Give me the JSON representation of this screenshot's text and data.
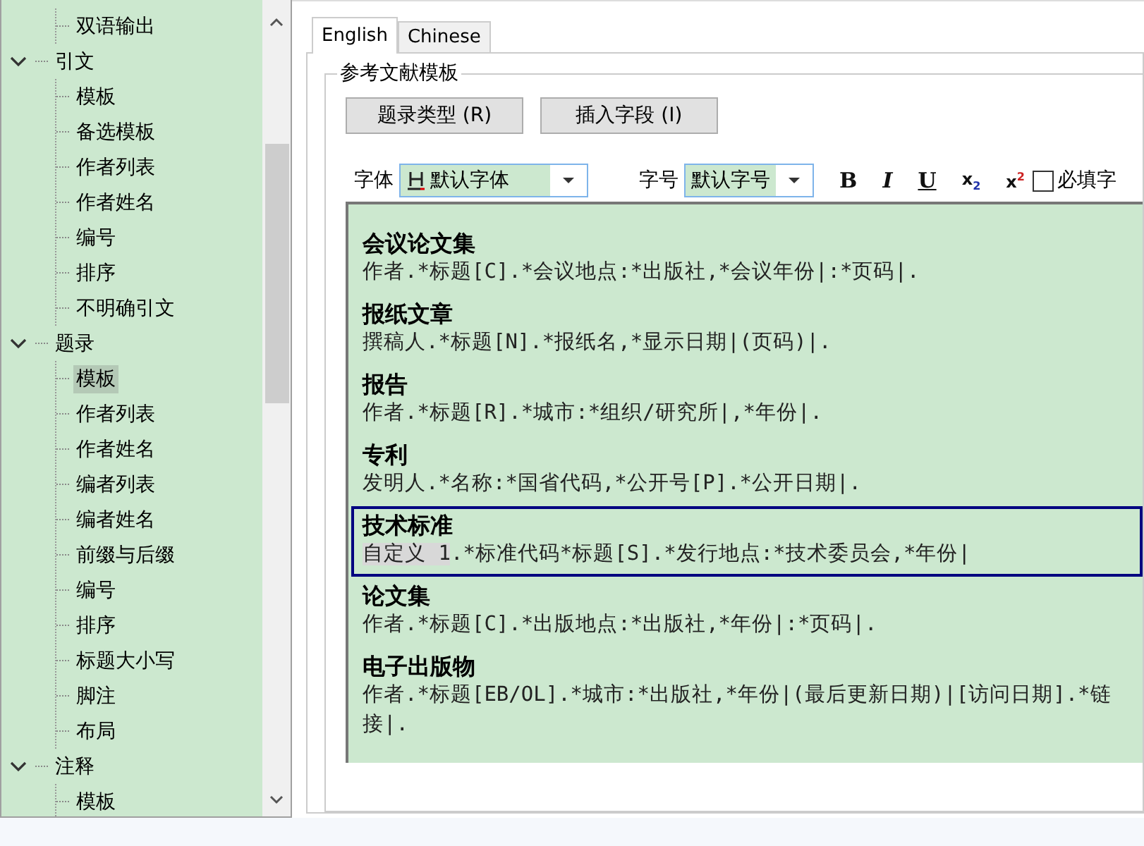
{
  "tree": {
    "items": [
      {
        "label": "双语输出",
        "selected": false
      },
      {
        "label": "引文",
        "expanded": true,
        "selected": false,
        "children": [
          {
            "label": "模板",
            "selected": false
          },
          {
            "label": "备选模板",
            "selected": false
          },
          {
            "label": "作者列表",
            "selected": false
          },
          {
            "label": "作者姓名",
            "selected": false
          },
          {
            "label": "编号",
            "selected": false
          },
          {
            "label": "排序",
            "selected": false
          },
          {
            "label": "不明确引文",
            "selected": false
          }
        ]
      },
      {
        "label": "题录",
        "expanded": true,
        "selected": false,
        "children": [
          {
            "label": "模板",
            "selected": true
          },
          {
            "label": "作者列表",
            "selected": false
          },
          {
            "label": "作者姓名",
            "selected": false
          },
          {
            "label": "编者列表",
            "selected": false
          },
          {
            "label": "编者姓名",
            "selected": false
          },
          {
            "label": "前缀与后缀",
            "selected": false
          },
          {
            "label": "编号",
            "selected": false
          },
          {
            "label": "排序",
            "selected": false
          },
          {
            "label": "标题大小写",
            "selected": false
          },
          {
            "label": "脚注",
            "selected": false
          },
          {
            "label": "布局",
            "selected": false
          }
        ]
      },
      {
        "label": "注释",
        "expanded": true,
        "selected": false,
        "children": [
          {
            "label": "模板",
            "selected": false
          }
        ]
      }
    ]
  },
  "tabs": [
    {
      "label": "English",
      "selected": true
    },
    {
      "label": "Chinese",
      "selected": false
    }
  ],
  "group_title": "参考文献模板",
  "buttons": [
    "题录类型 (R)",
    "插入字段 (I)"
  ],
  "toolbar": {
    "font_label": "字体",
    "font_value": "默认字体",
    "size_label": "字号",
    "size_value": "默认字号",
    "format_buttons": [
      {
        "kind": "bold",
        "label": "B"
      },
      {
        "kind": "italic",
        "label": "I"
      },
      {
        "kind": "underline",
        "label": "U"
      },
      {
        "kind": "subscript",
        "label": "x",
        "mark": "2"
      },
      {
        "kind": "superscript",
        "label": "x",
        "mark": "2"
      }
    ],
    "required": {
      "label": "必填字",
      "checked": false
    }
  },
  "entries": [
    {
      "name": "会议论文集",
      "format": "作者.*标题[C].*会议地点:*出版社,*会议年份|:*页码|.",
      "selected": false
    },
    {
      "name": "报纸文章",
      "format": "撰稿人.*标题[N].*报纸名,*显示日期|(页码)|.",
      "selected": false
    },
    {
      "name": "报告",
      "format": "作者.*标题[R].*城市:*组织/研究所|,*年份|.",
      "selected": false
    },
    {
      "name": "专利",
      "format": "发明人.*名称:*国省代码,*公开号[P].*公开日期|.",
      "selected": false
    },
    {
      "name": "技术标准",
      "field": "自定义 1",
      "format": ".*标准代码*标题[S].*发行地点:*技术委员会,*年份|",
      "selected": true
    },
    {
      "name": "论文集",
      "format": "作者.*标题[C].*出版地点:*出版社,*年份|:*页码|.",
      "selected": false
    },
    {
      "name": "电子出版物",
      "format": "作者.*标题[EB/OL].*城市:*出版社,*年份|(最后更新日期)|[访问日期].*链接|.",
      "selected": false
    }
  ]
}
